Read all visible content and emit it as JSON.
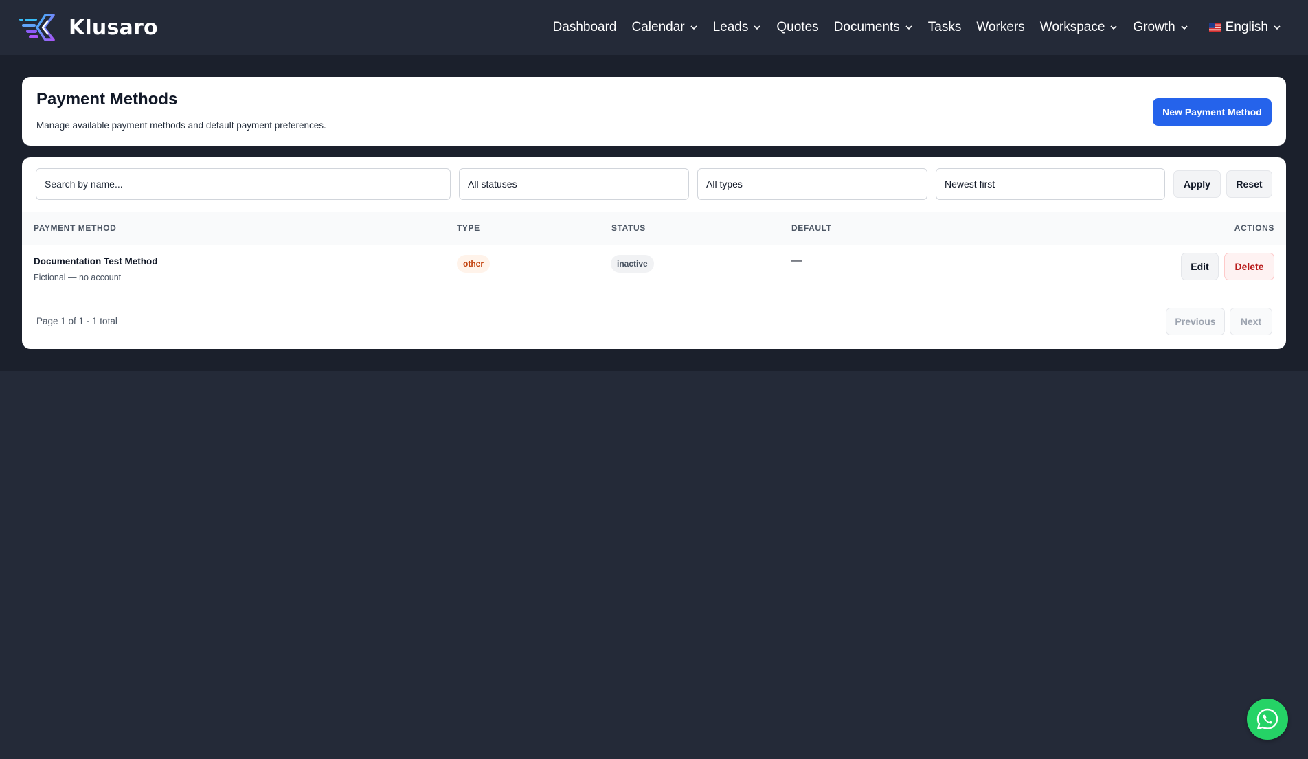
{
  "app": {
    "name": "Klusaro",
    "accent": "#2563eb"
  },
  "nav": {
    "items": [
      {
        "label": "Dashboard",
        "dropdown": false
      },
      {
        "label": "Calendar",
        "dropdown": true
      },
      {
        "label": "Leads",
        "dropdown": true
      },
      {
        "label": "Quotes",
        "dropdown": false
      },
      {
        "label": "Documents",
        "dropdown": true
      },
      {
        "label": "Tasks",
        "dropdown": false
      },
      {
        "label": "Workers",
        "dropdown": false
      },
      {
        "label": "Workspace",
        "dropdown": true
      },
      {
        "label": "Growth",
        "dropdown": true
      }
    ],
    "language": {
      "label": "English",
      "flag_icon": "us-flag-icon"
    }
  },
  "header": {
    "title": "Payment Methods",
    "subtitle": "Manage available payment methods and default payment preferences.",
    "new_button_label": "New Payment Method"
  },
  "filters": {
    "search_placeholder": "Search by name...",
    "status_value": "All statuses",
    "type_value": "All types",
    "sort_value": "Newest first",
    "apply_label": "Apply",
    "reset_label": "Reset"
  },
  "table": {
    "columns": {
      "method": "Payment Method",
      "type": "Type",
      "status": "Status",
      "default": "Default",
      "actions": "Actions"
    },
    "rows": [
      {
        "name": "Documentation Test Method",
        "description": "Fictional — no account",
        "type": "other",
        "status": "inactive",
        "default": "—",
        "edit_label": "Edit",
        "delete_label": "Delete"
      }
    ]
  },
  "pagination": {
    "summary": "Page 1 of 1 · 1 total",
    "previous_label": "Previous",
    "next_label": "Next"
  },
  "chat_widget": {
    "icon": "whatsapp-icon",
    "color": "#25d366"
  }
}
